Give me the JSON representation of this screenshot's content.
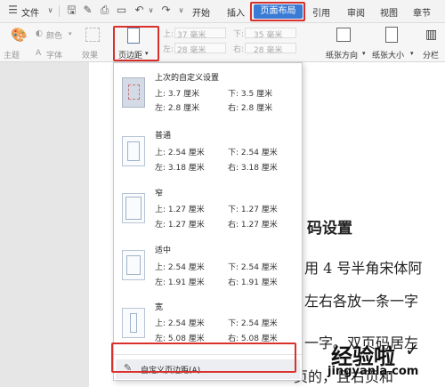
{
  "menubar": {
    "file_label": "文件",
    "tabs": [
      "开始",
      "插入",
      "页面布局",
      "引用",
      "审阅",
      "视图",
      "章节"
    ],
    "active_tab": "页面布局"
  },
  "ribbon": {
    "theme_label": "主题",
    "color_label": "颜色",
    "font_label": "字体",
    "effect_label": "效果",
    "margins_button": "页边距",
    "top_value": "37 毫米",
    "bottom_value": "35 毫米",
    "left_value": "28 毫米",
    "right_value": "28 毫米",
    "orientation_label": "纸张方向",
    "size_label": "纸张大小",
    "columns_label": "分栏"
  },
  "margins_menu": {
    "options": [
      {
        "name": "上次的自定义设置",
        "top": "上: 3.7 厘米",
        "bottom": "下: 3.5 厘米",
        "left": "左: 2.8 厘米",
        "right": "右: 2.8 厘米"
      },
      {
        "name": "普通",
        "top": "上: 2.54 厘米",
        "bottom": "下: 2.54 厘米",
        "left": "左: 3.18 厘米",
        "right": "右: 3.18 厘米"
      },
      {
        "name": "窄",
        "top": "上: 1.27 厘米",
        "bottom": "下: 1.27 厘米",
        "left": "左: 1.27 厘米",
        "right": "右: 1.27 厘米"
      },
      {
        "name": "适中",
        "top": "上: 2.54 厘米",
        "bottom": "下: 2.54 厘米",
        "left": "左: 1.91 厘米",
        "right": "右: 1.91 厘米"
      },
      {
        "name": "宽",
        "top": "上: 2.54 厘米",
        "bottom": "下: 2.54 厘米",
        "left": "左: 5.08 厘米",
        "right": "右: 5.08 厘米"
      }
    ],
    "custom_label": "自定义页边距(A)..."
  },
  "document": {
    "lines": [
      "码设置",
      "用 4 号半角宋体阿",
      "左右各放一条一字",
      "一字。双页码居左",
      "页的，且右页和"
    ]
  },
  "watermark": {
    "line1": "经验啦",
    "line2": "jingyanla.com"
  },
  "colors": {
    "accent": "#3a7bd5",
    "highlight_border": "#d9302c"
  }
}
